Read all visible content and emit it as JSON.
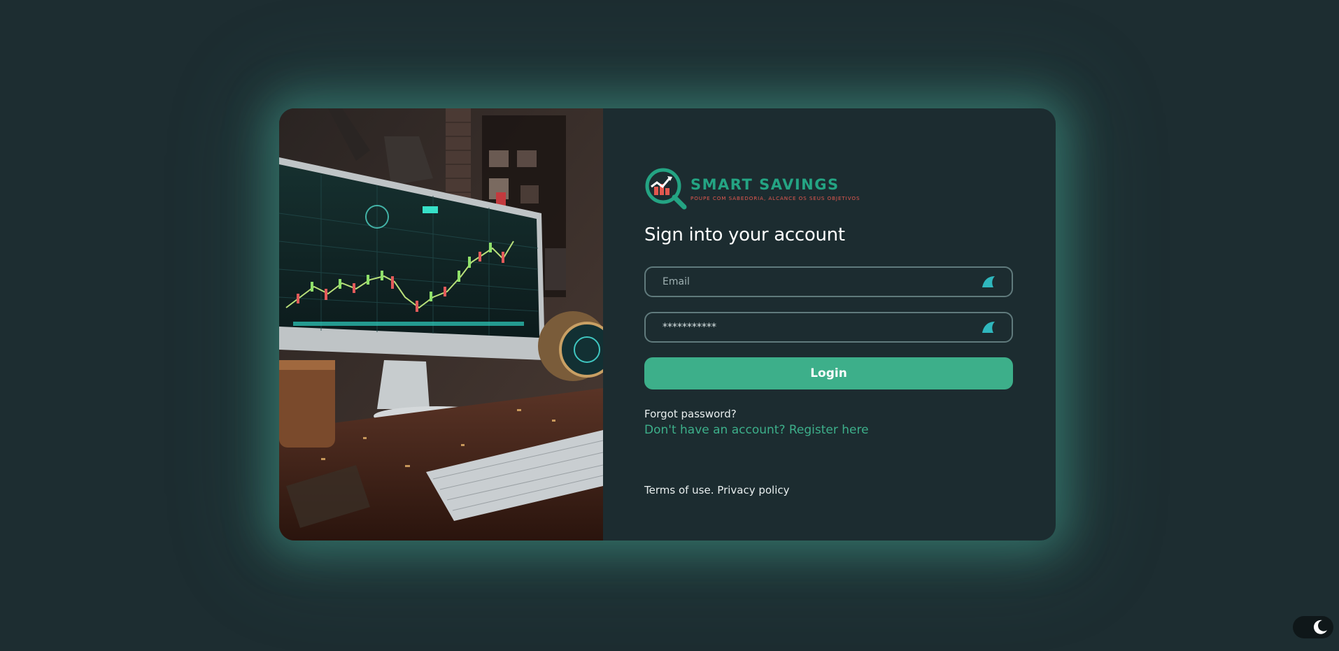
{
  "brand": {
    "name": "SMART SAVINGS",
    "tagline": "POUPE COM SABEDORIA, ALCANCE OS SEUS OBJETIVOS",
    "logo_icon": "magnifier-chart-icon"
  },
  "login": {
    "title": "Sign into your account",
    "email": {
      "placeholder": "Email",
      "value": "",
      "icon": "shark-fin-icon"
    },
    "password": {
      "placeholder": "",
      "value": "***********",
      "icon": "shark-fin-icon"
    },
    "submit_label": "Login",
    "forgot_label": "Forgot password?",
    "register_label": "Don't have an account? Register here"
  },
  "footer": {
    "terms_label": "Terms of use.",
    "privacy_label": "Privacy policy"
  },
  "theme_toggle": {
    "icon": "moon-icon",
    "mode": "dark"
  },
  "colors": {
    "background": "#1d2d31",
    "accent": "#3daf8a",
    "brand_green": "#24a483",
    "brand_red": "#e2584f"
  }
}
